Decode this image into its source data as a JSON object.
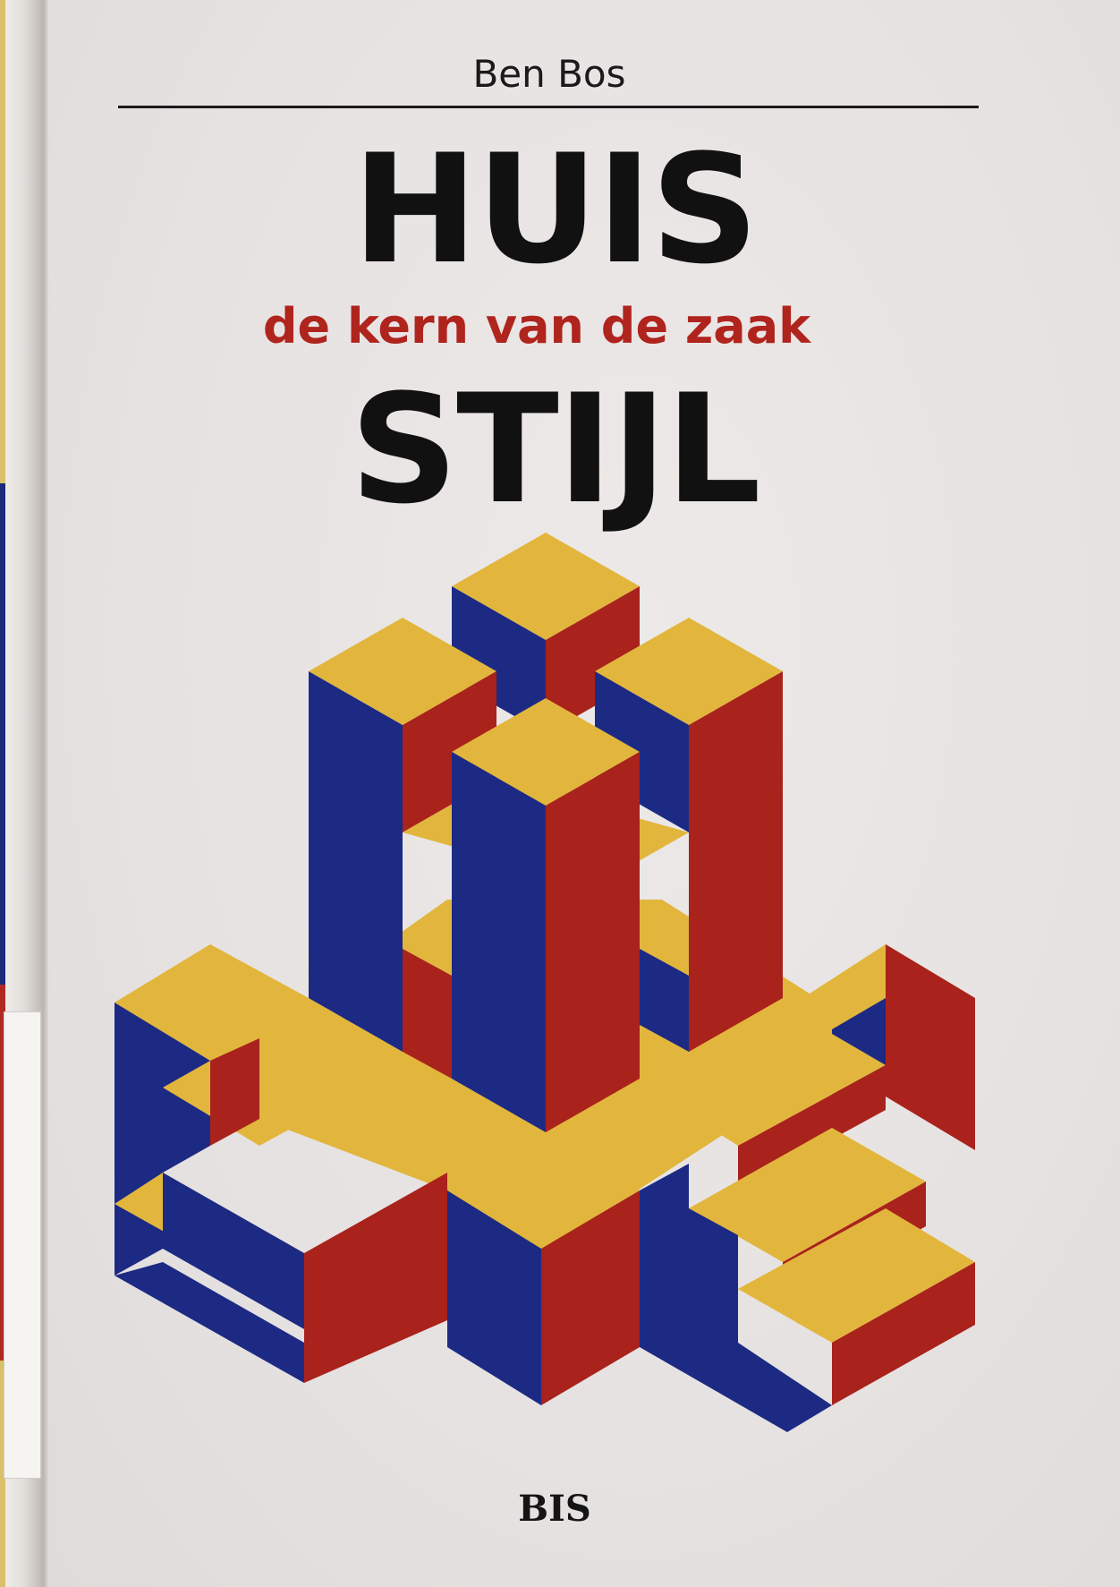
{
  "cover": {
    "author": "Ben Bos",
    "title_top": "HUIS",
    "subtitle": "de kern van de zaak",
    "title_bottom": "STIJL",
    "publisher": "BIS"
  },
  "colors": {
    "yellow": "#e2b63d",
    "blue": "#1c2a84",
    "red": "#a9221c",
    "subtitle_red": "#b0241e",
    "paper": "#e9e5e4"
  },
  "illustration": {
    "icon": "isometric-h-block-sculpture"
  }
}
